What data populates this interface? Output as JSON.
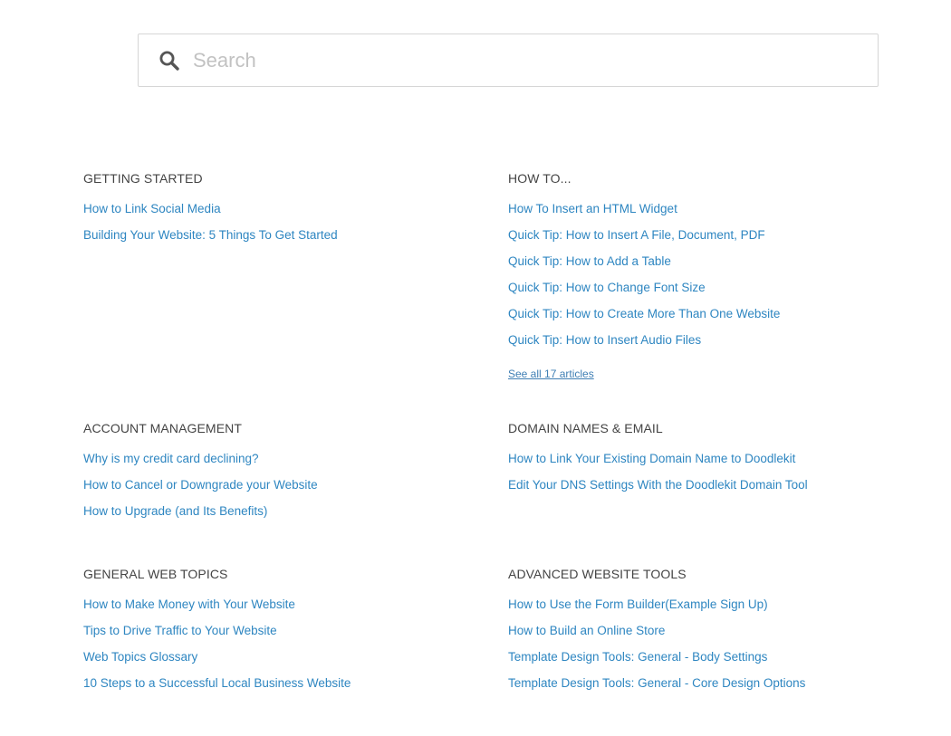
{
  "search": {
    "placeholder": "Search"
  },
  "colors": {
    "link": "#2e86c1",
    "heading": "#444444",
    "border": "#d6d6d6"
  },
  "sections": [
    {
      "title": "GETTING STARTED",
      "articles": [
        "How to Link Social Media",
        "Building Your Website: 5 Things To Get Started"
      ]
    },
    {
      "title": "HOW TO...",
      "articles": [
        "How To Insert an HTML Widget",
        "Quick Tip: How to Insert A File, Document, PDF",
        "Quick Tip: How to Add a Table",
        "Quick Tip: How to Change Font Size",
        "Quick Tip: How to Create More Than One Website",
        "Quick Tip: How to Insert Audio Files"
      ],
      "see_all": "See all 17 articles"
    },
    {
      "title": "ACCOUNT MANAGEMENT",
      "articles": [
        "Why is my credit card declining?",
        "How to Cancel or Downgrade your Website",
        "How to Upgrade (and Its Benefits)"
      ]
    },
    {
      "title": "DOMAIN NAMES & EMAIL",
      "articles": [
        "How to Link Your Existing Domain Name to Doodlekit",
        "Edit Your DNS Settings With the Doodlekit Domain Tool"
      ]
    },
    {
      "title": "GENERAL WEB TOPICS",
      "articles": [
        "How to Make Money with Your Website",
        "Tips to Drive Traffic to Your Website",
        "Web Topics Glossary",
        "10 Steps to a Successful Local Business Website"
      ]
    },
    {
      "title": "ADVANCED WEBSITE TOOLS",
      "articles": [
        "How to Use the Form Builder(Example Sign Up)",
        "How to Build an Online Store",
        "Template Design Tools: General - Body Settings",
        "Template Design Tools: General - Core Design Options"
      ]
    }
  ]
}
